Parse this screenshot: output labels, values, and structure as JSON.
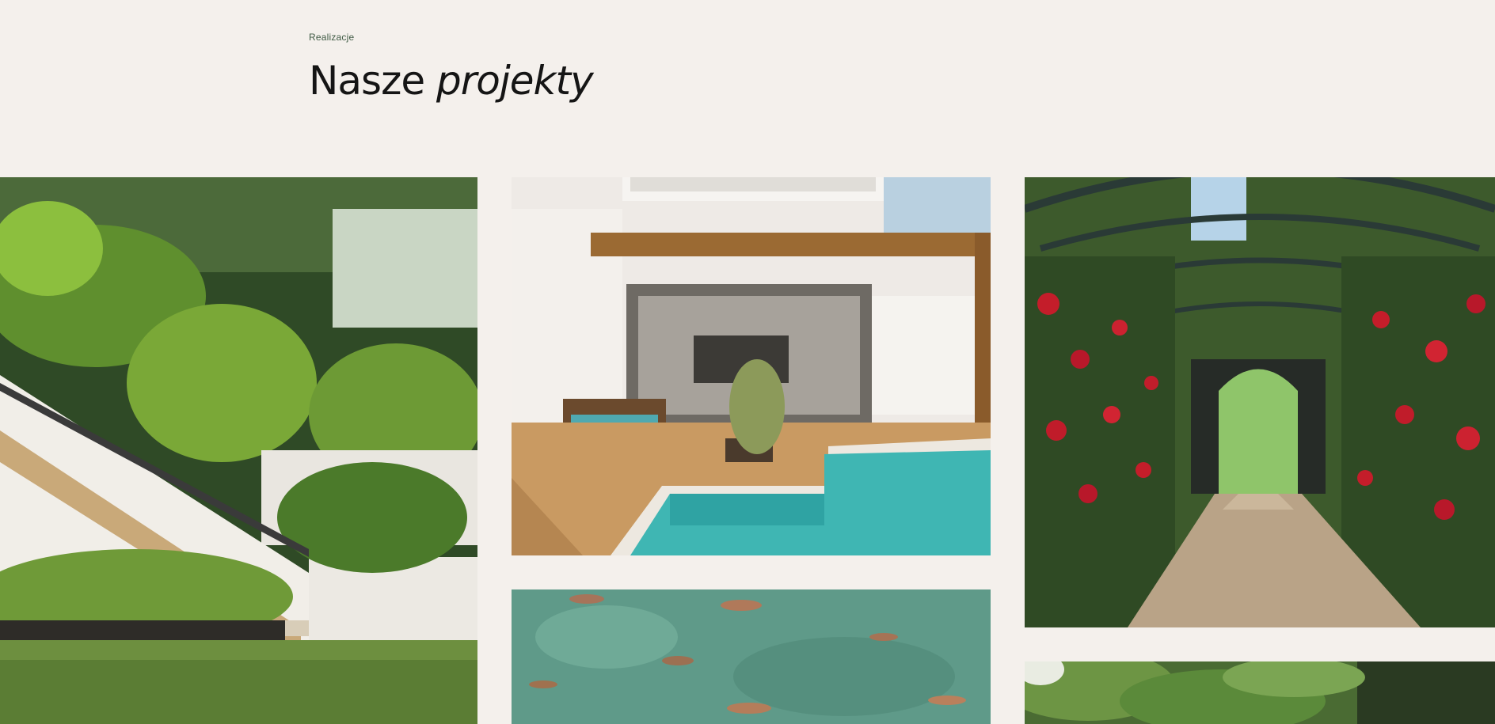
{
  "section": {
    "eyebrow": "Realizacje",
    "title_regular": "Nasze",
    "title_italic": "projekty"
  },
  "colors": {
    "background": "#f4f0ec",
    "eyebrow": "#3f5a44",
    "heading": "#151515"
  },
  "projects": [
    {
      "subject": "tropical garden with glass-railed staircase"
    },
    {
      "subject": "pool terrace with wooden pergola"
    },
    {
      "subject": "koi pond"
    },
    {
      "subject": "rose arch garden path"
    },
    {
      "subject": "tropical foliage garden"
    }
  ]
}
